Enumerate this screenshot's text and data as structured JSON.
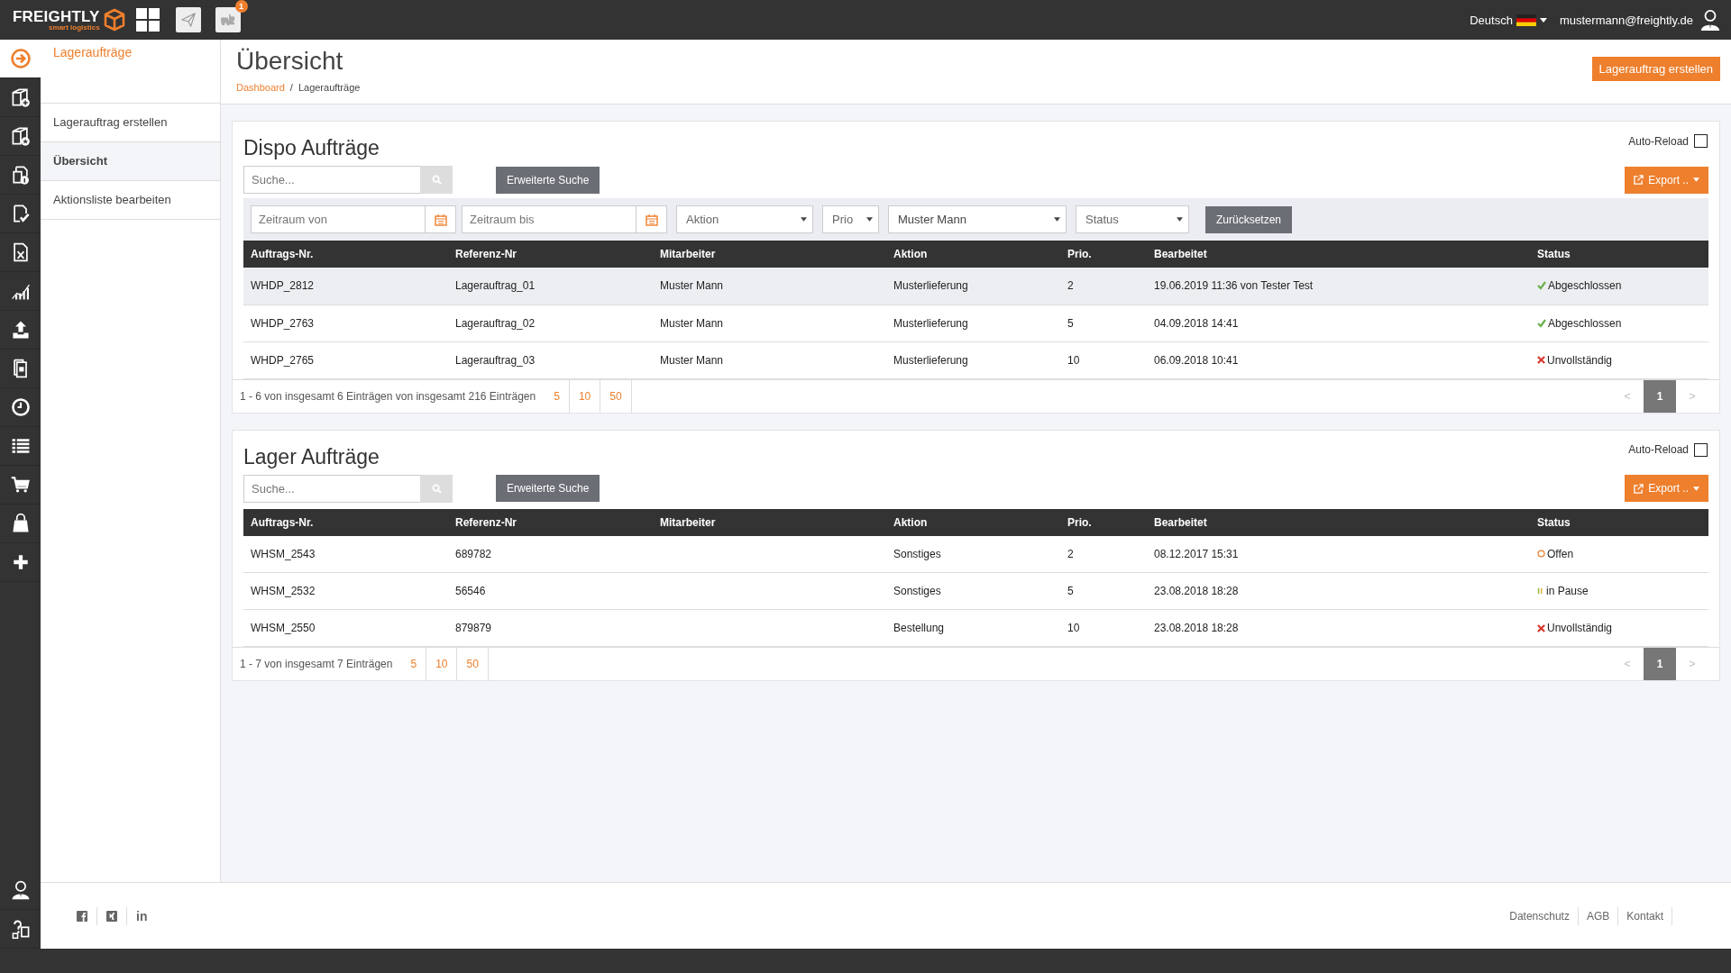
{
  "topbar": {
    "logo": "FREIGHTLY",
    "tagline": "smart logistics",
    "notification_count": "1",
    "language": "Deutsch",
    "user_email": "mustermann@freightly.de"
  },
  "rail": {
    "items": [
      {
        "selected": true
      },
      {
        "selected": false
      },
      {
        "selected": false
      },
      {
        "selected": false
      },
      {
        "selected": false
      },
      {
        "selected": false
      },
      {
        "selected": false
      },
      {
        "selected": false
      },
      {
        "selected": false
      },
      {
        "selected": false
      },
      {
        "selected": false
      },
      {
        "selected": false
      },
      {
        "selected": false
      },
      {
        "selected": false
      }
    ],
    "bottom_items": [
      {
        "selected": false
      },
      {
        "selected": false
      }
    ]
  },
  "subnav": {
    "title": "Lageraufträge",
    "items": [
      {
        "label": "Lagerauftrag erstellen",
        "selected": false
      },
      {
        "label": "Übersicht",
        "selected": true
      },
      {
        "label": "Aktionsliste bearbeiten",
        "selected": false
      }
    ]
  },
  "header": {
    "title": "Übersicht",
    "breadcrumb": [
      "Dashboard",
      "Lageraufträge"
    ],
    "breadcrumb_separator": "/",
    "create_button": "Lagerauftrag erstellen"
  },
  "cards": [
    {
      "title": "Dispo Aufträge",
      "auto_reload": {
        "label": "Auto-Reload",
        "checked": false
      },
      "search": {
        "placeholder": "Suche..."
      },
      "advanced_search": "Erweiterte Suche",
      "export": "Export ..",
      "filters": [
        {
          "kind": "date",
          "placeholder": "Zeitraum von"
        },
        {
          "kind": "date",
          "placeholder": "Zeitraum bis"
        },
        {
          "kind": "select",
          "placeholder": "Aktion"
        },
        {
          "kind": "select",
          "placeholder": "Prio"
        },
        {
          "kind": "select",
          "value": "Muster Mann"
        },
        {
          "kind": "select",
          "placeholder": "Status"
        }
      ],
      "reset": "Zurücksetzen",
      "table": {
        "columns": [
          "Auftrags-Nr.",
          "Referenz-Nr",
          "Mitarbeiter",
          "Aktion",
          "Prio.",
          "Bearbeitet",
          "Status"
        ],
        "rows": [
          {
            "auftrags_nr": "WHDP_2812",
            "referenz_nr": "Lagerauftrag_01",
            "mitarbeiter": "Muster Mann",
            "aktion": "Musterlieferung",
            "prio": "2",
            "bearbeitet": "19.06.2019 11:36 von Tester Test",
            "status": {
              "kind": "done",
              "text": "Abgeschlossen"
            },
            "selected": true
          },
          {
            "auftrags_nr": "WHDP_2763",
            "referenz_nr": "Lagerauftrag_02",
            "mitarbeiter": "Muster Mann",
            "aktion": "Musterlieferung",
            "prio": "5",
            "bearbeitet": "04.09.2018 14:41",
            "status": {
              "kind": "done",
              "text": "Abgeschlossen"
            },
            "selected": false
          },
          {
            "auftrags_nr": "WHDP_2765",
            "referenz_nr": "Lagerauftrag_03",
            "mitarbeiter": "Muster Mann",
            "aktion": "Musterlieferung",
            "prio": "10",
            "bearbeitet": "06.09.2018 10:41",
            "status": {
              "kind": "incomplete",
              "text": "Unvollständig"
            },
            "selected": false
          }
        ]
      },
      "footer": {
        "summary": "1 - 6 von insgesamt 6 Einträgen von insgesamt 216 Einträgen",
        "page_sizes": [
          "5",
          "10",
          "50"
        ],
        "prev": {
          "label": "<",
          "disabled": true
        },
        "pages": [
          {
            "label": "1",
            "selected": true
          }
        ],
        "next": {
          "label": ">",
          "disabled": true
        }
      }
    },
    {
      "title": "Lager Aufträge",
      "auto_reload": {
        "label": "Auto-Reload",
        "checked": false
      },
      "search": {
        "placeholder": "Suche..."
      },
      "advanced_search": "Erweiterte Suche",
      "export": "Export ..",
      "table": {
        "columns": [
          "Auftrags-Nr.",
          "Referenz-Nr",
          "Mitarbeiter",
          "Aktion",
          "Prio.",
          "Bearbeitet",
          "Status"
        ],
        "rows": [
          {
            "auftrags_nr": "WHSM_2543",
            "referenz_nr": "689782",
            "aktion": "Sonstiges",
            "prio": "2",
            "bearbeitet": "08.12.2017 15:31",
            "status": {
              "kind": "open",
              "text": "Offen"
            },
            "selected": false
          },
          {
            "auftrags_nr": "WHSM_2532",
            "referenz_nr": "56546",
            "aktion": "Sonstiges",
            "prio": "5",
            "bearbeitet": "23.08.2018 18:28",
            "status": {
              "kind": "paused",
              "text": "in Pause"
            },
            "selected": false
          },
          {
            "auftrags_nr": "WHSM_2550",
            "referenz_nr": "879879",
            "aktion": "Bestellung",
            "prio": "10",
            "bearbeitet": "23.08.2018 18:28",
            "status": {
              "kind": "incomplete",
              "text": "Unvollständig"
            },
            "selected": false
          }
        ]
      },
      "footer": {
        "summary": "1 - 7 von insgesamt 7 Einträgen",
        "page_sizes": [
          "5",
          "10",
          "50"
        ],
        "prev": {
          "label": "<",
          "disabled": true
        },
        "pages": [
          {
            "label": "1",
            "selected": true
          }
        ],
        "next": {
          "label": ">",
          "disabled": true
        }
      }
    }
  ],
  "footer": {
    "social": [
      {
        "kind": "facebook"
      },
      {
        "kind": "xing"
      },
      {
        "kind": "linkedin",
        "text": "in"
      }
    ],
    "links": [
      "Datenschutz",
      "AGB",
      "Kontakt"
    ]
  }
}
